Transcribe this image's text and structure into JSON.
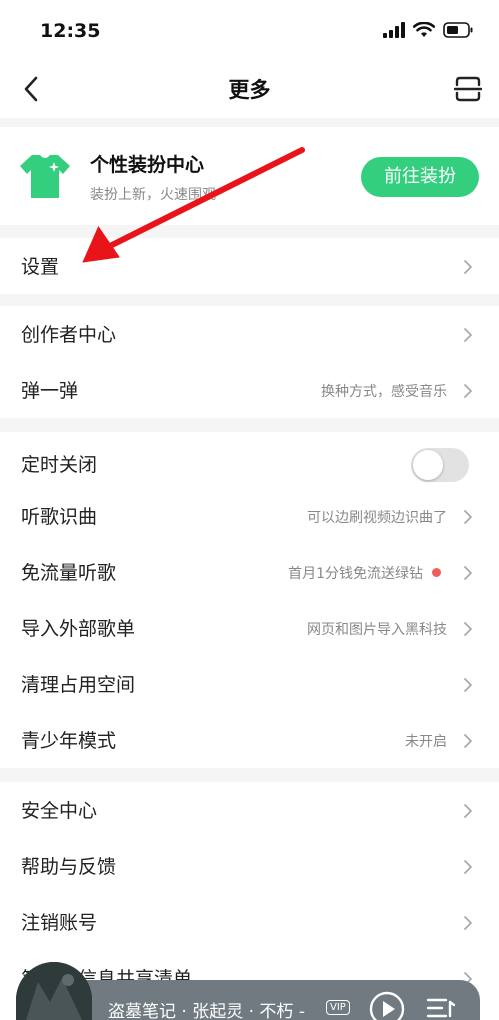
{
  "status_bar": {
    "time": "12:35"
  },
  "nav": {
    "title": "更多"
  },
  "dress_center": {
    "title": "个性装扮中心",
    "subtitle": "装扮上新，火速围观",
    "button_label": "前往装扮"
  },
  "settings": {
    "label": "设置"
  },
  "group2": [
    {
      "label": "创作者中心",
      "hint": ""
    },
    {
      "label": "弹一弹",
      "hint": "换种方式，感受音乐"
    }
  ],
  "group3": {
    "timer": {
      "label": "定时关闭",
      "toggle_on": false
    },
    "rows": [
      {
        "label": "听歌识曲",
        "hint": "可以边刷视频边识曲了"
      },
      {
        "label": "免流量听歌",
        "hint": "首月1分钱免流送绿钻",
        "dot": true
      },
      {
        "label": "导入外部歌单",
        "hint": "网页和图片导入黑科技"
      },
      {
        "label": "清理占用空间",
        "hint": ""
      },
      {
        "label": "青少年模式",
        "hint": "未开启"
      }
    ]
  },
  "group4": [
    {
      "label": "安全中心"
    },
    {
      "label": "帮助与反馈"
    },
    {
      "label": "注销账号"
    },
    {
      "label": "第三方信息共享清单"
    }
  ],
  "player": {
    "now_playing": "盗墓笔记 · 张起灵 · 不朽 -",
    "vip_label": "VIP"
  },
  "colors": {
    "accent_green": "#33cf7f",
    "annotation_red": "#e8141a",
    "notice_dot": "#f15d5d"
  }
}
